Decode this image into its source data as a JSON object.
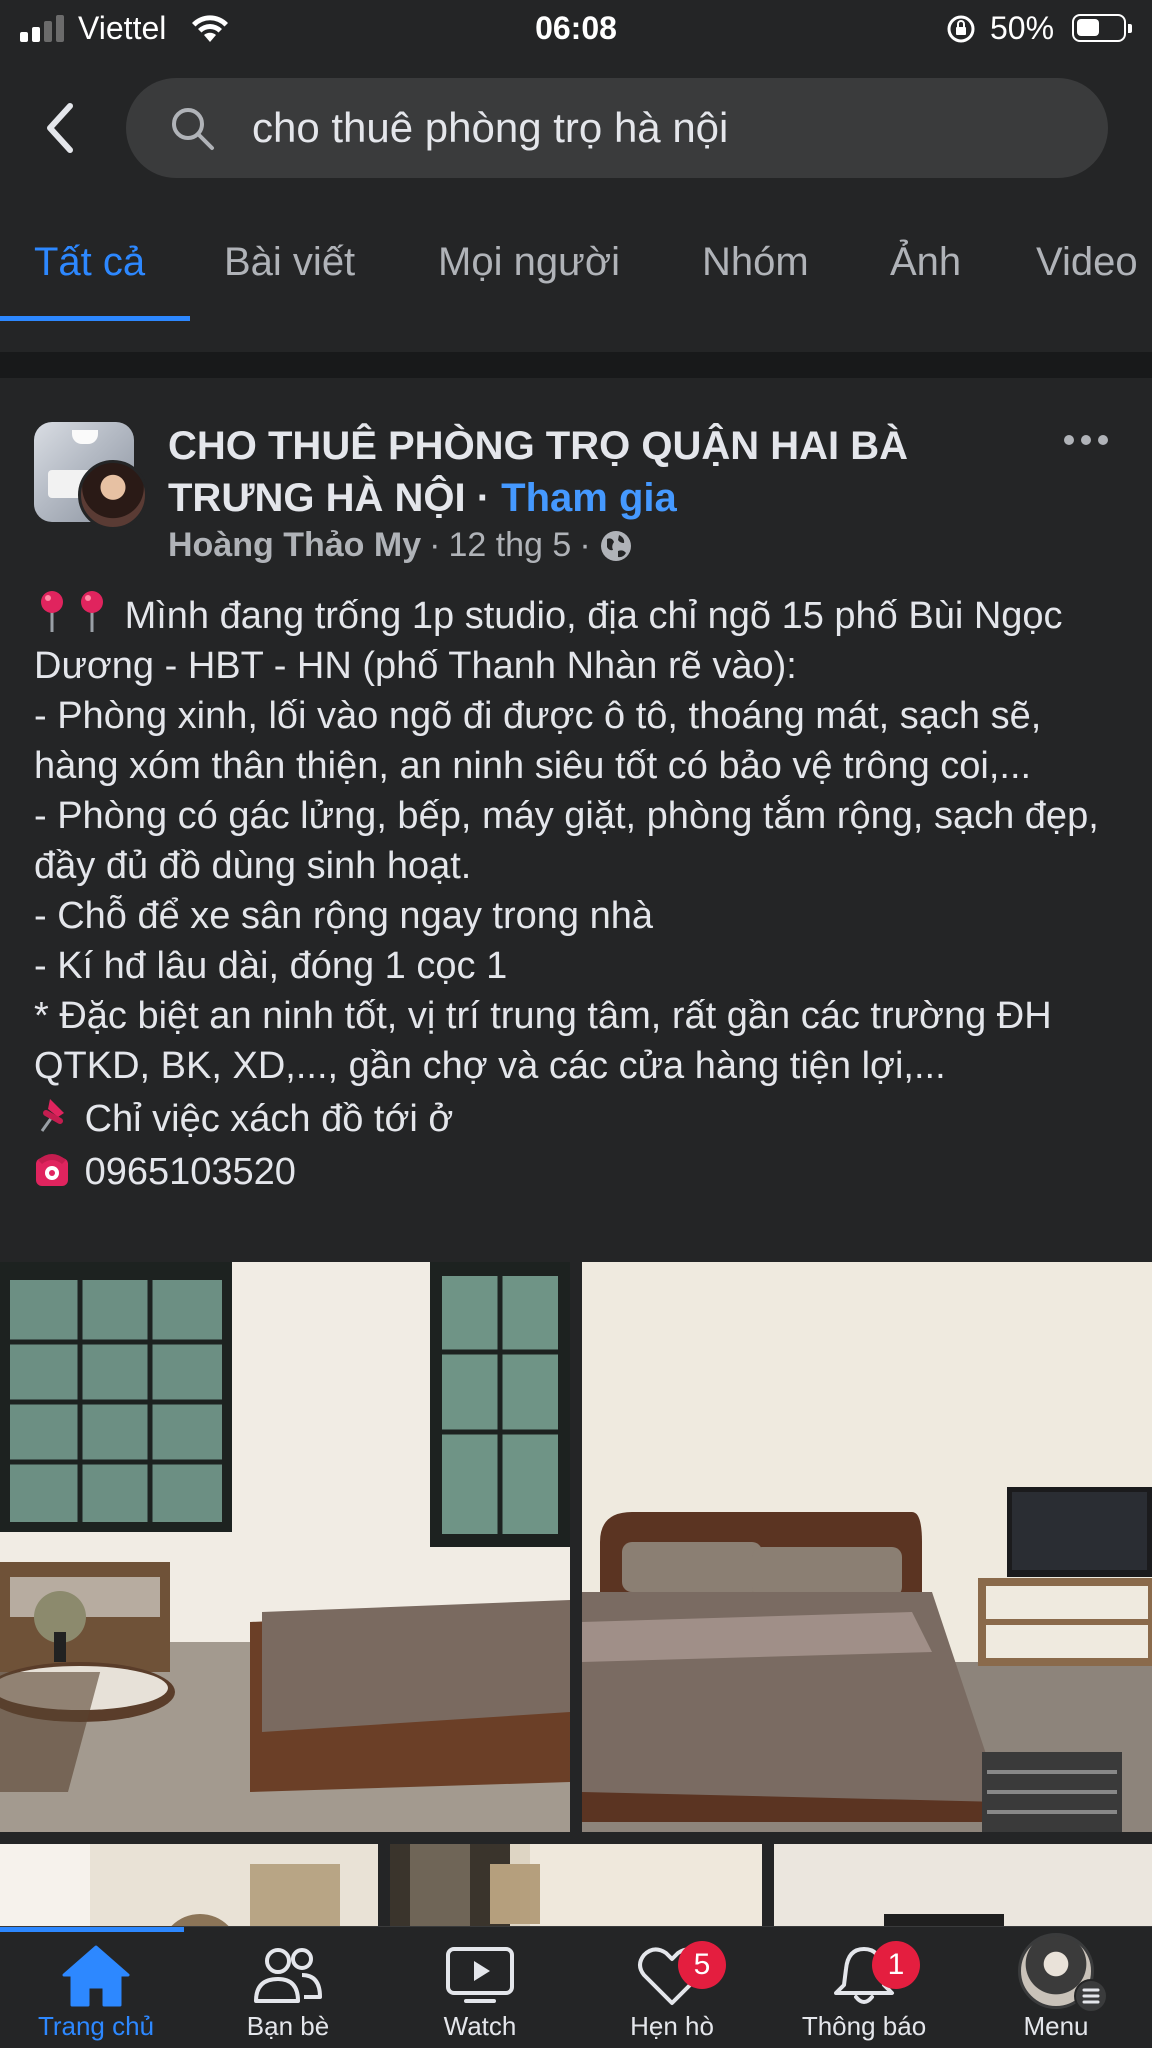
{
  "status_bar": {
    "carrier": "Viettel",
    "time": "06:08",
    "battery_percent": "50%",
    "battery_level": 0.5
  },
  "search": {
    "query": "cho thuê phòng trọ hà nội"
  },
  "tabs": [
    {
      "label": "Tất cả",
      "active": true
    },
    {
      "label": "Bài viết"
    },
    {
      "label": "Mọi người"
    },
    {
      "label": "Nhóm"
    },
    {
      "label": "Ảnh"
    },
    {
      "label": "Video"
    }
  ],
  "post": {
    "group_title": "CHO THUÊ PHÒNG TRỌ QUẬN HAI BÀ TRƯNG HÀ NỘI",
    "separator": " · ",
    "join_label": "Tham gia",
    "author": "Hoàng Thảo My",
    "date": "12 thg 5",
    "body_lines": [
      "Mình đang trống 1p studio, địa chỉ ngõ 15 phố Bùi Ngọc Dương - HBT - HN (phố Thanh Nhàn rẽ vào):",
      "- Phòng xinh, lối vào ngõ đi được ô tô, thoáng mát, sạch sẽ, hàng xóm thân thiện, an ninh siêu tốt có bảo vệ trông coi,...",
      "- Phòng có gác lửng, bếp, máy giặt, phòng tắm rộng, sạch đẹp, đầy đủ đồ dùng sinh hoạt.",
      "- Chỗ để xe sân rộng ngay trong nhà",
      "- Kí hđ lâu dài, đóng 1 cọc 1",
      "* Đặc biệt an ninh tốt, vị trí trung tâm, rất gần các trường ĐH QTKD, BK, XD,..., gần chợ và các cửa hàng tiện lợi,...",
      "Chỉ việc xách đồ tới ở",
      "0965103520"
    ],
    "icons": {
      "intro": "round-pushpin-icon",
      "move_in": "pushpin-icon",
      "phone": "telephone-icon",
      "privacy": "globe-icon"
    }
  },
  "bottom_nav": [
    {
      "label": "Trang chủ",
      "icon": "home-icon",
      "active": true
    },
    {
      "label": "Bạn bè",
      "icon": "friends-icon"
    },
    {
      "label": "Watch",
      "icon": "watch-icon"
    },
    {
      "label": "Hẹn hò",
      "icon": "dating-icon",
      "badge": "5"
    },
    {
      "label": "Thông báo",
      "icon": "bell-icon",
      "badge": "1"
    },
    {
      "label": "Menu",
      "icon": "profile-avatar"
    }
  ],
  "colors": {
    "background": "#242526",
    "accent": "#2d88ff",
    "badge": "#e41e3f",
    "secondary_text": "#b0b3b8"
  }
}
